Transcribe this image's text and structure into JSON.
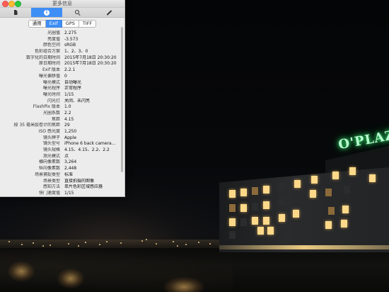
{
  "window": {
    "title": "更多信息"
  },
  "toolbar": {
    "buttons": [
      {
        "icon": "document-icon"
      },
      {
        "icon": "info-icon",
        "label": "i",
        "active": true
      },
      {
        "icon": "search-icon"
      },
      {
        "icon": "pen-icon"
      }
    ]
  },
  "tabs": [
    "通用",
    "Exif",
    "GPS",
    "TIFF"
  ],
  "active_tab": "Exif",
  "exif": [
    {
      "key": "光圈值",
      "value": "2.275"
    },
    {
      "key": "亮度值",
      "value": "-3.573"
    },
    {
      "key": "颜色空间",
      "value": "sRGB"
    },
    {
      "key": "色彩组合方案",
      "value": "1、2、3、0"
    },
    {
      "key": "数字化的日期时间",
      "value": "2015年7月18日 20:30:20"
    },
    {
      "key": "原日期时间",
      "value": "2015年7月18日 20:30:20"
    },
    {
      "key": "Exif 版本",
      "value": "2.2.1"
    },
    {
      "key": "曝光偏移值",
      "value": "0"
    },
    {
      "key": "曝光模式",
      "value": "自动曝光"
    },
    {
      "key": "曝光程序",
      "value": "正常程序"
    },
    {
      "key": "曝光时间",
      "value": "1/15"
    },
    {
      "key": "闪光灯",
      "value": "关闭、未闪亮"
    },
    {
      "key": "FlashPix 版本",
      "value": "1.0"
    },
    {
      "key": "光圈系数",
      "value": "2.2"
    },
    {
      "key": "焦距",
      "value": "4.15"
    },
    {
      "key": "按 35 毫米胶卷计的焦距",
      "value": "29"
    },
    {
      "key": "ISO 感光度",
      "value": "1,250"
    },
    {
      "key": "镜头牌子",
      "value": "Apple"
    },
    {
      "key": "镜头型号",
      "value": "iPhone 6 back camera..."
    },
    {
      "key": "镜头规格",
      "value": "4.15、4.15、2.2、2.2"
    },
    {
      "key": "测光模式",
      "value": "点"
    },
    {
      "key": "横向像素数",
      "value": "3,264"
    },
    {
      "key": "纵向像素数",
      "value": "2,448"
    },
    {
      "key": "场景捕捉类型",
      "value": "标准"
    },
    {
      "key": "场景类型",
      "value": "直接拍摄的图像"
    },
    {
      "key": "感知方法",
      "value": "单片色彩区域感应器"
    },
    {
      "key": "快门速度值",
      "value": "1/15"
    }
  ],
  "photo": {
    "sign_text": "O'PLAZA"
  },
  "colors": {
    "accent": "#3f8ef6",
    "sign_glow": "#3cff7a",
    "window_light": "#ffd98a"
  }
}
